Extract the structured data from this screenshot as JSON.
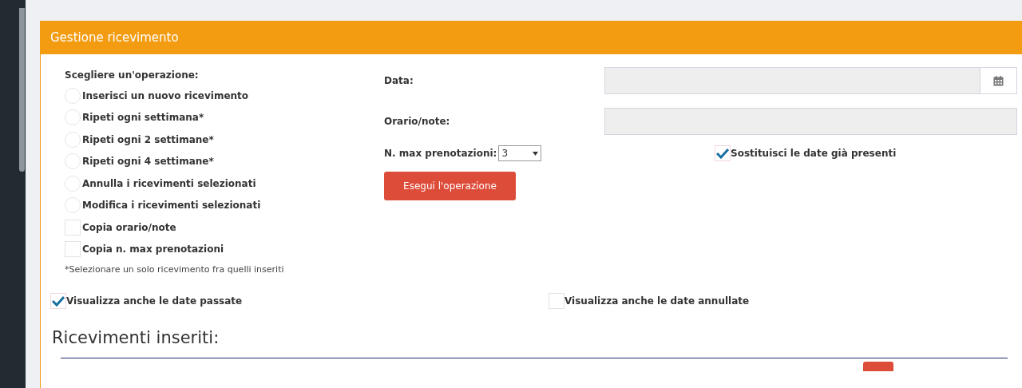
{
  "panel": {
    "title": "Gestione ricevimento"
  },
  "operations": {
    "label": "Scegliere un'operazione:",
    "options": [
      {
        "kind": "radio",
        "label": "Inserisci un nuovo ricevimento",
        "selected": false
      },
      {
        "kind": "radio",
        "label": "Ripeti ogni settimana*",
        "selected": false
      },
      {
        "kind": "radio",
        "label": "Ripeti ogni 2 settimane*",
        "selected": false
      },
      {
        "kind": "radio",
        "label": "Ripeti ogni 4 settimane*",
        "selected": false
      },
      {
        "kind": "radio",
        "label": "Annulla i ricevimenti selezionati",
        "selected": false
      },
      {
        "kind": "radio",
        "label": "Modifica i ricevimenti selezionati",
        "selected": false
      },
      {
        "kind": "checkbox",
        "label": "Copia orario/note",
        "checked": false
      },
      {
        "kind": "checkbox",
        "label": "Copia n. max prenotazioni",
        "checked": false
      }
    ],
    "note": "*Selezionare un solo ricevimento fra quelli inseriti"
  },
  "form": {
    "date_label": "Data:",
    "notes_label": "Orario/note:",
    "max_label": "N. max prenotazioni:",
    "max_value": "3",
    "replace": {
      "label": "Sostituisci le date già presenti",
      "checked": true
    },
    "submit": "Esegui l'operazione"
  },
  "filters": [
    {
      "label": "Visualizza anche le date passate",
      "checked": true
    },
    {
      "label": "Visualizza anche le date annullate",
      "checked": false
    }
  ],
  "list": {
    "title": "Ricevimenti inseriti:"
  }
}
